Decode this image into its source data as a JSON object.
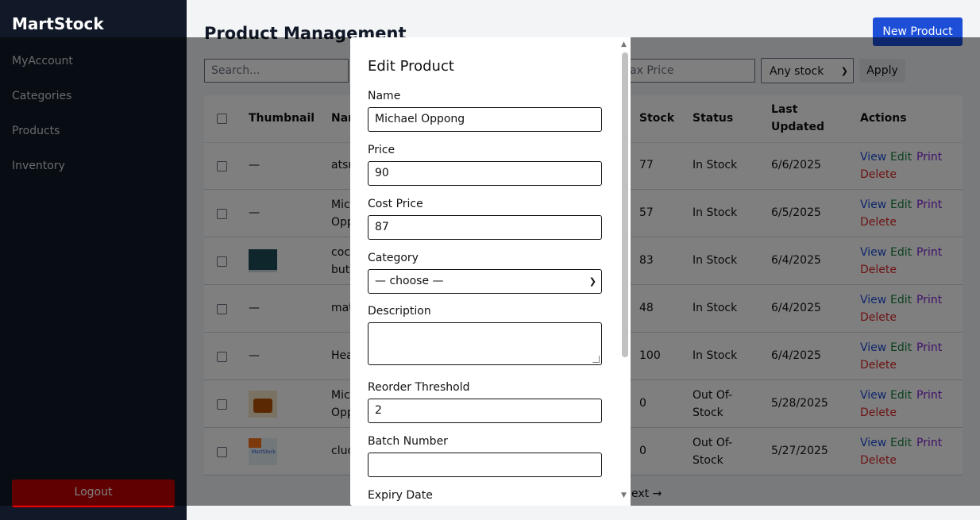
{
  "app": {
    "brand": "MartStock"
  },
  "sidebar": {
    "items": [
      {
        "label": "MyAccount"
      },
      {
        "label": "Categories"
      },
      {
        "label": "Products"
      },
      {
        "label": "Inventory"
      }
    ],
    "logout_label": "Logout"
  },
  "header": {
    "title": "Product Management",
    "new_button_label": "New Product"
  },
  "filters": {
    "search_placeholder": "Search...",
    "max_price_placeholder": "ax Price",
    "stock_selected": "Any stock",
    "apply_label": "Apply"
  },
  "table": {
    "headers": {
      "thumbnail": "Thumbnail",
      "name": "Nar",
      "stock": "Stock",
      "status": "Status",
      "last_updated_1": "Last",
      "last_updated_2": "Updated",
      "actions": "Actions"
    },
    "action_labels": {
      "view": "View",
      "edit": "Edit",
      "print": "Print",
      "delete": "Delete"
    },
    "rows": [
      {
        "thumb": "—",
        "name1": "atsr",
        "name2": "",
        "stock": "77",
        "status1": "In Stock",
        "status2": "",
        "updated": "6/6/2025"
      },
      {
        "thumb": "—",
        "name1": "Mic",
        "name2": "Opp",
        "stock": "57",
        "status1": "In Stock",
        "status2": "",
        "updated": "6/5/2025"
      },
      {
        "thumb": "",
        "name1": "coco",
        "name2": "butt",
        "stock": "83",
        "status1": "In Stock",
        "status2": "",
        "updated": "6/4/2025"
      },
      {
        "thumb": "—",
        "name1": "mat",
        "name2": "",
        "stock": "48",
        "status1": "In Stock",
        "status2": "",
        "updated": "6/4/2025"
      },
      {
        "thumb": "—",
        "name1": "Hea",
        "name2": "",
        "stock": "100",
        "status1": "In Stock",
        "status2": "",
        "updated": "6/4/2025"
      },
      {
        "thumb": "",
        "name1": "Mic",
        "name2": "Opp",
        "stock": "0",
        "status1": "Out Of-",
        "status2": "Stock",
        "updated": "5/28/2025"
      },
      {
        "thumb": "",
        "name1": "cluc",
        "name2": "",
        "stock": "0",
        "status1": "Out Of-",
        "status2": "Stock",
        "updated": "5/27/2025"
      }
    ],
    "pager_next": "ext →"
  },
  "modal": {
    "title": "Edit Product",
    "name_label": "Name",
    "name_value": "Michael Oppong",
    "price_label": "Price",
    "price_value": "90",
    "cost_label": "Cost Price",
    "cost_value": "87",
    "category_label": "Category",
    "category_value": "— choose —",
    "description_label": "Description",
    "reorder_label": "Reorder Threshold",
    "reorder_value": "2",
    "batch_label": "Batch Number",
    "expiry_label": "Expiry Date"
  },
  "colors": {
    "sidebar_bg": "#111827",
    "primary": "#1d4ed8",
    "logout": "#c00000"
  }
}
